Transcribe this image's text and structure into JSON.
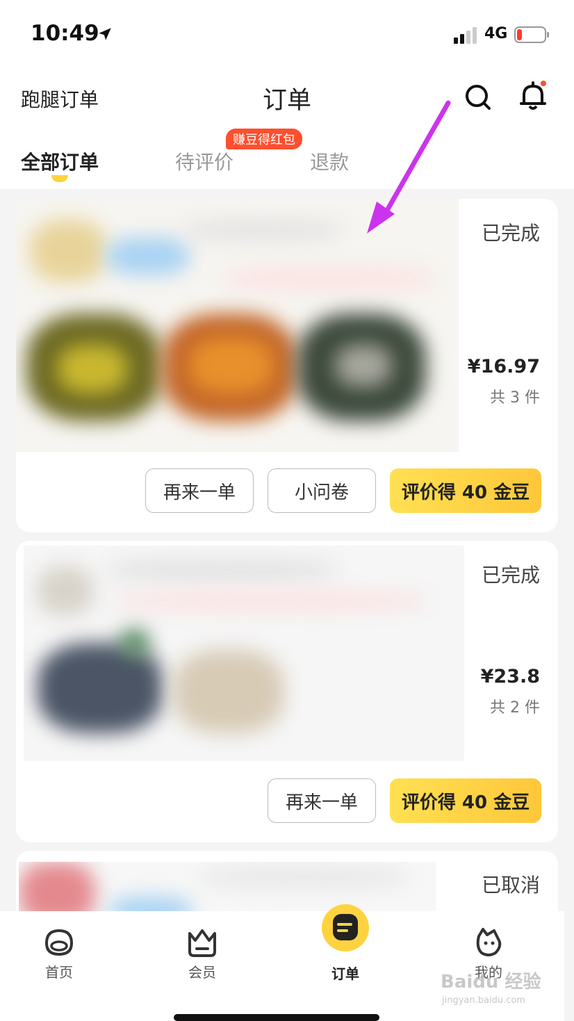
{
  "status_bar": {
    "time": "10:49",
    "network": "4G"
  },
  "header": {
    "left_link": "跑腿订单",
    "title": "订单",
    "search_icon": "search-icon",
    "bell_icon": "bell-icon"
  },
  "tabs": [
    {
      "label": "全部订单",
      "active": true
    },
    {
      "label": "待评价",
      "badge": "赚豆得红包"
    },
    {
      "label": "退款"
    }
  ],
  "orders": [
    {
      "status": "已完成",
      "price": "¥16.97",
      "count": "共 3 件",
      "buttons": [
        "再来一单",
        "小问卷",
        "评价得 40 金豆"
      ]
    },
    {
      "status": "已完成",
      "price": "¥23.8",
      "count": "共 2 件",
      "buttons": [
        "再来一单",
        "评价得 40 金豆"
      ]
    },
    {
      "status": "已取消"
    }
  ],
  "tabbar": [
    {
      "label": "首页",
      "icon": "home-icon"
    },
    {
      "label": "会员",
      "icon": "member-icon"
    },
    {
      "label": "订单",
      "icon": "order-icon",
      "active": true
    },
    {
      "label": "我的",
      "icon": "profile-icon"
    }
  ],
  "watermark": {
    "brand": "Baidu 经验",
    "url": "jingyan.baidu.com"
  },
  "colors": {
    "accent": "#ffd23f",
    "badge": "#ff4f2e",
    "arrow": "#cc33ee"
  }
}
